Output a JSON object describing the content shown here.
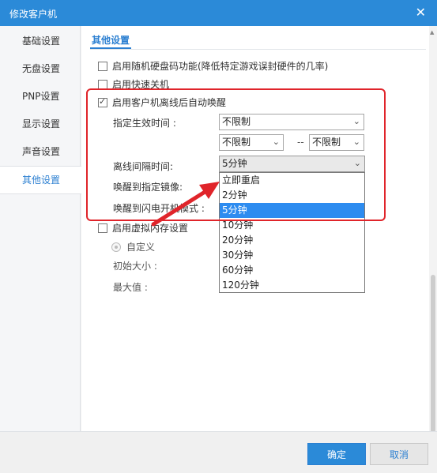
{
  "window": {
    "title": "修改客户机",
    "close_glyph": "✕"
  },
  "sidebar": {
    "items": [
      {
        "label": "基础设置"
      },
      {
        "label": "无盘设置"
      },
      {
        "label": "PNP设置"
      },
      {
        "label": "显示设置"
      },
      {
        "label": "声音设置"
      },
      {
        "label": "其他设置",
        "active": true
      }
    ]
  },
  "main": {
    "tab": "其他设置",
    "options": {
      "random_disk": "启用随机硬盘码功能(降低特定游戏误封硬件的几率)",
      "quick_shutdown": "启用快速关机",
      "offline_wake": "启用客户机离线后自动唤醒",
      "virtual_memory": "启用虚拟内存设置"
    },
    "effective_time_label": "指定生效时间 :",
    "effective_time_value": "不限制",
    "time_from": "不限制",
    "time_separator": "--",
    "time_to": "不限制",
    "offline_interval_label": "离线间隔时间:",
    "offline_interval_value": "5分钟",
    "wake_image_label": "唤醒到指定镜像:",
    "wake_flash_label": "唤醒到闪电开机模式 :",
    "custom_label": "自定义",
    "initial_size_label": "初始大小 :",
    "max_value_label": "最大值 :"
  },
  "dropdown": {
    "options": [
      "立即重启",
      "2分钟",
      "5分钟",
      "10分钟",
      "20分钟",
      "30分钟",
      "60分钟",
      "120分钟"
    ],
    "selected": "5分钟"
  },
  "footer": {
    "ok_label": "确定",
    "cancel_label": "取消"
  },
  "annotations": {
    "highlight_color": "#e0242a",
    "accent_color": "#2b7fd1"
  }
}
